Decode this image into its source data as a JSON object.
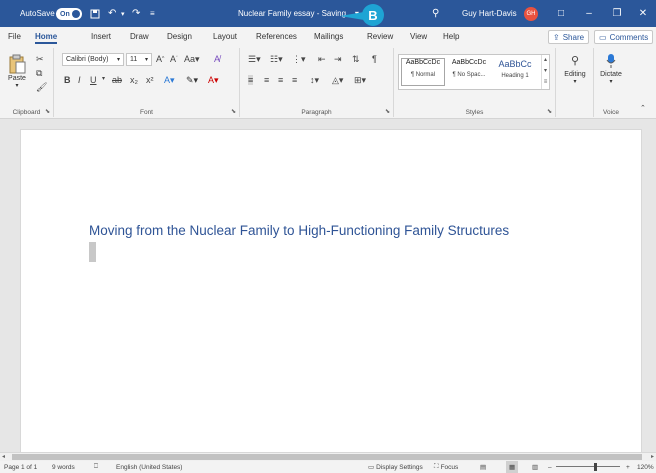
{
  "titlebar": {
    "autosave_label": "AutoSave",
    "autosave_state": "On",
    "save_icon": "save-icon",
    "undo_icon": "undo-icon",
    "redo_icon": "redo-icon",
    "doc_title": "Nuclear Family essay - Saving... ▾",
    "callout_letter": "B",
    "search_icon": "search-icon",
    "user_name": "Guy Hart-Davis",
    "user_initials": "GH",
    "window_buttons": [
      "□",
      "–",
      "❐",
      "✕"
    ]
  },
  "tabs": [
    "File",
    "Home",
    "Insert",
    "Draw",
    "Design",
    "Layout",
    "References",
    "Mailings",
    "Review",
    "View",
    "Help"
  ],
  "active_tab": "Home",
  "share_label": "Share",
  "comments_label": "Comments",
  "ribbon": {
    "clipboard": {
      "paste_label": "Paste",
      "group_label": "Clipboard"
    },
    "font": {
      "font_name": "Calibri (Body)",
      "font_size": "11",
      "group_label": "Font"
    },
    "paragraph": {
      "group_label": "Paragraph"
    },
    "styles": {
      "items": [
        {
          "sample": "AaBbCcDc",
          "name": "¶ Normal"
        },
        {
          "sample": "AaBbCcDc",
          "name": "¶ No Spac..."
        },
        {
          "sample": "AaBbCc",
          "name": "Heading 1"
        }
      ],
      "group_label": "Styles"
    },
    "editing": {
      "label": "Editing"
    },
    "voice": {
      "dictate_label": "Dictate",
      "group_label": "Voice"
    }
  },
  "document": {
    "heading": "Moving from the Nuclear Family to High-Functioning Family Structures"
  },
  "statusbar": {
    "page": "Page 1 of 1",
    "words": "9 words",
    "language": "English (United States)",
    "display_settings": "Display Settings",
    "focus": "Focus",
    "zoom_minus": "–",
    "zoom_plus": "+",
    "zoom_level": "120%"
  },
  "colors": {
    "accent": "#2b579a",
    "heading": "#2f5496",
    "callout": "#1ea4d4",
    "avatar": "#e8523f"
  }
}
